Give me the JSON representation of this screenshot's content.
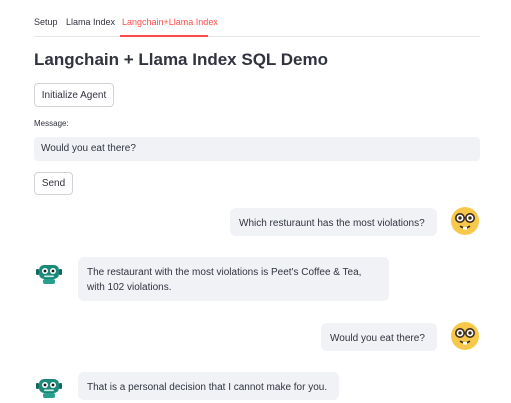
{
  "tabs": [
    {
      "label": "Setup"
    },
    {
      "label": "Llama Index"
    },
    {
      "label": "Langchain+Llama Index"
    }
  ],
  "title": "Langchain + Llama Index SQL Demo",
  "init_button": "Initialize Agent",
  "message": {
    "label": "Message:",
    "value": "Would you eat there?"
  },
  "send_button": "Send",
  "chat": [
    {
      "role": "user",
      "text": "Which resturaunt has the most violations?",
      "avatar": "nerd-face-icon"
    },
    {
      "role": "bot",
      "text": "The restaurant with the most violations is Peet's Coffee & Tea, with 102 violations.",
      "avatar": "robot-icon"
    },
    {
      "role": "user",
      "text": "Would you eat there?",
      "avatar": "nerd-face-icon"
    },
    {
      "role": "bot",
      "text": "That is a personal decision that I cannot make for you.",
      "avatar": "robot-icon"
    }
  ],
  "colors": {
    "accent": "#ff4b4b",
    "bubble": "#f0f2f6",
    "robot": "#1b8a7a",
    "emoji": "#f7c84a"
  }
}
